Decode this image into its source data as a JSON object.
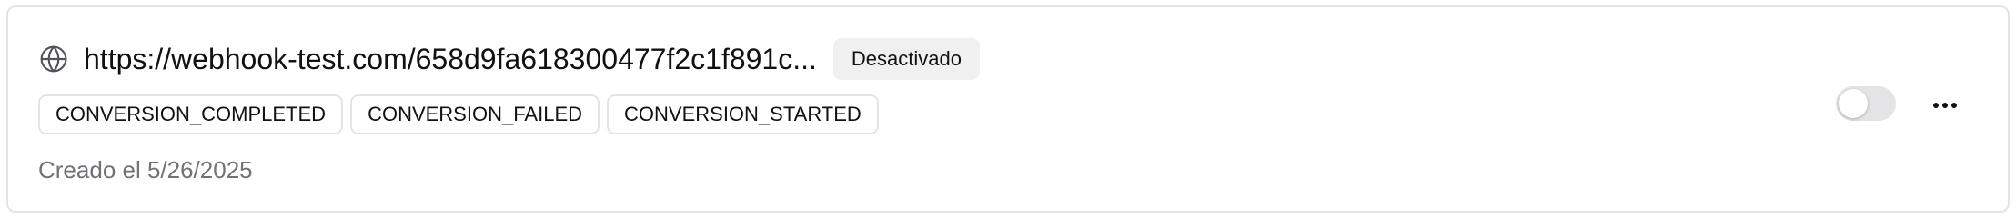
{
  "webhook": {
    "url": "https://webhook-test.com/658d9fa618300477f2c1f891c...",
    "status": "Desactivado",
    "events": [
      "CONVERSION_COMPLETED",
      "CONVERSION_FAILED",
      "CONVERSION_STARTED"
    ],
    "created": "Creado el 5/26/2025",
    "enabled": false
  },
  "icons": {
    "url": "globe-icon",
    "more": "more-horizontal-icon"
  },
  "colors": {
    "border": "#e4e4e7",
    "badge_bg": "#f0f0f1",
    "muted_text": "#71717a",
    "toggle_off": "#e4e4e7"
  }
}
